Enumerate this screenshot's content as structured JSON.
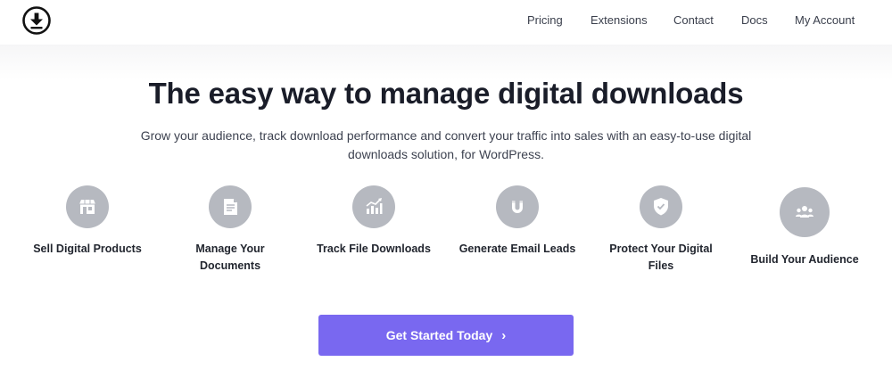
{
  "header": {
    "logo_icon": "download-circle-icon",
    "nav": [
      {
        "label": "Pricing"
      },
      {
        "label": "Extensions"
      },
      {
        "label": "Contact"
      },
      {
        "label": "Docs"
      },
      {
        "label": "My Account"
      }
    ]
  },
  "hero": {
    "title": "The easy way to manage digital downloads",
    "subtitle_line1": "Grow your audience, track download performance and convert your traffic into sales with an easy-to-use digital",
    "subtitle_line2": "downloads solution, for WordPress."
  },
  "features": [
    {
      "icon": "storefront-icon",
      "label": "Sell Digital Products"
    },
    {
      "icon": "document-icon",
      "label": "Manage Your Documents"
    },
    {
      "icon": "chart-icon",
      "label": "Track File Downloads"
    },
    {
      "icon": "magnet-icon",
      "label": "Generate Email Leads"
    },
    {
      "icon": "shield-icon",
      "label": "Protect Your Digital Files"
    },
    {
      "icon": "users-icon",
      "label": "Build Your Audience"
    }
  ],
  "cta": {
    "label": "Get Started Today",
    "chevron": "›",
    "color": "#7968f0"
  },
  "colors": {
    "icon_circle": "#b6b9c0",
    "text_dark": "#1a1d29"
  }
}
